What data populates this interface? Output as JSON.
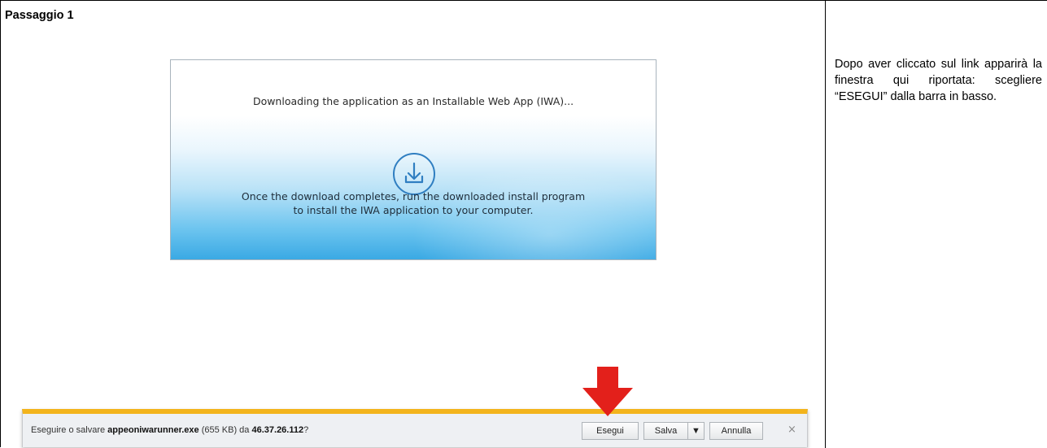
{
  "step": {
    "title": "Passaggio 1"
  },
  "instruction": {
    "text": "Dopo aver cliccato sul link apparirà la finestra qui riportata: scegliere “ESEGUI” dalla barra in basso."
  },
  "dialog": {
    "downloading_text": "Downloading the application as an Installable Web App (IWA)...",
    "complete_line1": "Once the download completes, run the downloaded install program",
    "complete_line2": "to install the IWA application to your computer.",
    "icon": "download-icon"
  },
  "download_bar": {
    "prompt_prefix": "Eseguire o salvare ",
    "file_name": "appeoniwarunner.exe",
    "file_size": " (655 KB) da ",
    "host": "46.37.26.112",
    "prompt_suffix": "?",
    "run_label": "Esegui",
    "save_label": "Salva",
    "dropdown_glyph": "▼",
    "cancel_label": "Annulla",
    "close_glyph": "×",
    "accent_color": "#f3b41c"
  },
  "annotation": {
    "arrow_color": "#e3201b",
    "icon": "arrow-down-icon"
  }
}
